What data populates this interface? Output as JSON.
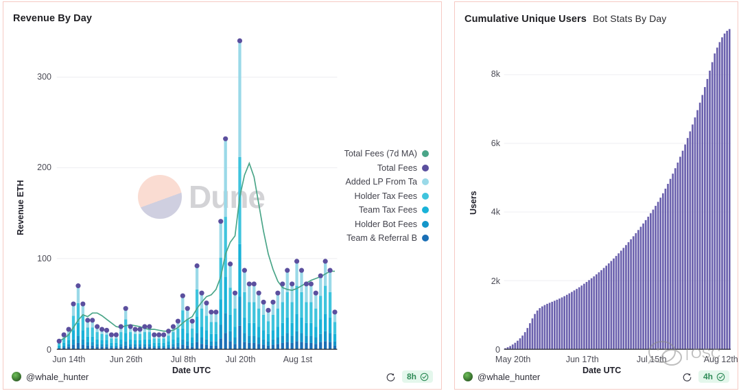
{
  "panels": {
    "left": {
      "title": "Revenue By Day",
      "subtitle": "",
      "user": "@whale_hunter",
      "freshness": "8h",
      "icons": {
        "refresh": "refresh-icon",
        "check": "check-circle-icon",
        "avatar": "avatar-icon"
      }
    },
    "right": {
      "title": "Cumulative Unique Users",
      "subtitle": "Bot Stats By Day",
      "user": "@whale_hunter",
      "freshness": "4h",
      "icons": {
        "refresh": "refresh-icon",
        "check": "check-circle-icon",
        "avatar": "avatar-icon"
      }
    }
  },
  "watermark": {
    "text": "Dune",
    "circle_top": "#fadcd2",
    "circle_bottom": "#cfcfe0"
  },
  "colors": {
    "panel_border": "#f6c9c3",
    "total_fees_ma": "#4aa588",
    "total_fees": "#5b4f9e",
    "added_lp": "#9ad9e8",
    "holder_tax": "#3fc4dd",
    "team_tax": "#19b2d8",
    "holder_bot": "#1496c9",
    "team_referral": "#1a6fb5",
    "users_bar": "#6a60ad",
    "grid": "#ededf1"
  },
  "chart_data": [
    {
      "type": "bar",
      "id": "revenue-by-day",
      "title": "Revenue By Day",
      "xlabel": "Date UTC",
      "ylabel": "Revenue ETH",
      "ylim": [
        0,
        345
      ],
      "yticks": [
        "0",
        "100",
        "200",
        "300"
      ],
      "ytick_values": [
        0,
        100,
        200,
        300
      ],
      "xticks": [
        "Jun 14th",
        "Jun 26th",
        "Jul 8th",
        "Jul 20th",
        "Aug 1st"
      ],
      "xtick_indices": [
        2,
        14,
        26,
        38,
        50
      ],
      "grid": true,
      "legend_position": "right",
      "stacked": true,
      "legend": [
        {
          "label": "Total Fees (7d MA)",
          "color": "#4aa588",
          "kind": "line"
        },
        {
          "label": "Total Fees",
          "color": "#5b4f9e",
          "kind": "scatter"
        },
        {
          "label": "Added LP From Ta",
          "color": "#9ad9e8",
          "kind": "bar"
        },
        {
          "label": "Holder Tax Fees",
          "color": "#3fc4dd",
          "kind": "bar"
        },
        {
          "label": "Team Tax Fees",
          "color": "#19b2d8",
          "kind": "bar"
        },
        {
          "label": "Holder Bot Fees",
          "color": "#1496c9",
          "kind": "bar"
        },
        {
          "label": "Team & Referral B",
          "color": "#1a6fb5",
          "kind": "bar"
        }
      ],
      "categories": [
        "Jun 12th",
        "Jun 13th",
        "Jun 14th",
        "Jun 15th",
        "Jun 16th",
        "Jun 17th",
        "Jun 18th",
        "Jun 19th",
        "Jun 20th",
        "Jun 21st",
        "Jun 22nd",
        "Jun 23rd",
        "Jun 24th",
        "Jun 25th",
        "Jun 26th",
        "Jun 27th",
        "Jun 28th",
        "Jun 29th",
        "Jun 30th",
        "Jul 1st",
        "Jul 2nd",
        "Jul 3rd",
        "Jul 4th",
        "Jul 5th",
        "Jul 6th",
        "Jul 7th",
        "Jul 8th",
        "Jul 9th",
        "Jul 10th",
        "Jul 11th",
        "Jul 12th",
        "Jul 13th",
        "Jul 14th",
        "Jul 15th",
        "Jul 16th",
        "Jul 17th",
        "Jul 18th",
        "Jul 19th",
        "Jul 20th",
        "Jul 21st",
        "Jul 22nd",
        "Jul 23rd",
        "Jul 24th",
        "Jul 25th",
        "Jul 26th",
        "Jul 27th",
        "Jul 28th",
        "Jul 29th",
        "Jul 30th",
        "Jul 31st",
        "Aug 1st",
        "Aug 2nd",
        "Aug 3rd",
        "Aug 4th",
        "Aug 5th",
        "Aug 6th",
        "Aug 7th",
        "Aug 8th",
        "Aug 9th"
      ],
      "series": [
        {
          "name": "Team & Referral B",
          "color": "#1a6fb5",
          "values": [
            1,
            2,
            3,
            5,
            7,
            5,
            4,
            4,
            3,
            3,
            3,
            2,
            2,
            3,
            4,
            3,
            3,
            3,
            3,
            3,
            2,
            2,
            2,
            2,
            3,
            3,
            5,
            4,
            3,
            8,
            6,
            5,
            4,
            4,
            12,
            18,
            9,
            6,
            26,
            8,
            7,
            7,
            6,
            5,
            4,
            5,
            6,
            7,
            8,
            7,
            9,
            8,
            7,
            7,
            6,
            8,
            9,
            8,
            4
          ]
        },
        {
          "name": "Holder Bot Fees",
          "color": "#1496c9",
          "values": [
            1,
            2,
            3,
            6,
            8,
            6,
            4,
            4,
            3,
            3,
            3,
            2,
            2,
            3,
            5,
            3,
            3,
            3,
            3,
            3,
            2,
            2,
            2,
            3,
            3,
            4,
            6,
            5,
            4,
            10,
            7,
            6,
            5,
            5,
            15,
            22,
            11,
            7,
            32,
            10,
            8,
            8,
            7,
            6,
            5,
            6,
            7,
            8,
            10,
            8,
            11,
            10,
            8,
            8,
            7,
            9,
            11,
            10,
            5
          ]
        },
        {
          "name": "Team Tax Fees",
          "color": "#19b2d8",
          "values": [
            2,
            3,
            4,
            10,
            14,
            10,
            6,
            6,
            5,
            4,
            4,
            3,
            3,
            5,
            9,
            5,
            4,
            4,
            5,
            5,
            3,
            3,
            3,
            4,
            5,
            6,
            12,
            9,
            6,
            18,
            12,
            10,
            8,
            8,
            28,
            40,
            18,
            12,
            58,
            17,
            14,
            14,
            12,
            10,
            8,
            10,
            12,
            14,
            17,
            14,
            19,
            17,
            14,
            14,
            12,
            16,
            19,
            17,
            8
          ]
        },
        {
          "name": "Holder Tax Fees",
          "color": "#3fc4dd",
          "values": [
            3,
            5,
            7,
            16,
            22,
            16,
            10,
            10,
            8,
            7,
            6,
            5,
            5,
            8,
            15,
            8,
            7,
            7,
            8,
            8,
            5,
            5,
            5,
            6,
            8,
            10,
            20,
            15,
            10,
            30,
            20,
            16,
            13,
            13,
            46,
            66,
            30,
            20,
            96,
            28,
            23,
            23,
            20,
            17,
            14,
            17,
            20,
            23,
            28,
            23,
            31,
            28,
            23,
            23,
            20,
            26,
            31,
            28,
            13
          ]
        },
        {
          "name": "Added LP From Ta",
          "color": "#9ad9e8",
          "values": [
            2,
            4,
            5,
            13,
            19,
            13,
            8,
            8,
            6,
            5,
            5,
            4,
            4,
            6,
            12,
            6,
            5,
            5,
            6,
            6,
            4,
            4,
            4,
            5,
            6,
            8,
            16,
            12,
            8,
            26,
            17,
            14,
            11,
            11,
            40,
            86,
            26,
            17,
            128,
            24,
            20,
            20,
            17,
            14,
            12,
            14,
            17,
            20,
            24,
            20,
            27,
            24,
            20,
            20,
            17,
            22,
            27,
            24,
            11
          ]
        }
      ],
      "total_fees_points": [
        9,
        16,
        22,
        50,
        70,
        50,
        32,
        32,
        25,
        22,
        21,
        16,
        16,
        25,
        45,
        25,
        22,
        22,
        25,
        25,
        16,
        16,
        16,
        20,
        25,
        31,
        59,
        45,
        31,
        92,
        62,
        51,
        41,
        41,
        141,
        232,
        94,
        62,
        340,
        87,
        72,
        72,
        62,
        52,
        43,
        52,
        62,
        72,
        87,
        72,
        97,
        87,
        72,
        72,
        62,
        81,
        97,
        87,
        41
      ],
      "total_fees_ma_7d": [
        9,
        12,
        16,
        24,
        32,
        38,
        36,
        40,
        40,
        37,
        33,
        29,
        25,
        24,
        26,
        27,
        26,
        25,
        23,
        22,
        22,
        21,
        20,
        20,
        21,
        24,
        29,
        33,
        36,
        45,
        52,
        58,
        60,
        66,
        80,
        105,
        118,
        125,
        168,
        192,
        205,
        190,
        160,
        130,
        105,
        88,
        75,
        68,
        66,
        65,
        67,
        70,
        73,
        76,
        78,
        80,
        83,
        86,
        86
      ]
    },
    {
      "type": "bar",
      "id": "cumulative-unique-users",
      "title": "Cumulative Unique Users",
      "subtitle": "Bot Stats By Day",
      "xlabel": "Date UTC",
      "ylabel": "Users",
      "ylim": [
        0,
        9400
      ],
      "yticks": [
        "0",
        "2k",
        "4k",
        "6k",
        "8k"
      ],
      "ytick_values": [
        0,
        2000,
        4000,
        6000,
        8000
      ],
      "xticks": [
        "May 20th",
        "Jun 17th",
        "Jul 15th",
        "Aug 12th"
      ],
      "xtick_indices": [
        3,
        31,
        59,
        87
      ],
      "grid": true,
      "color": "#6a60ad",
      "values": [
        30,
        60,
        95,
        140,
        190,
        250,
        320,
        400,
        500,
        620,
        760,
        900,
        1030,
        1130,
        1200,
        1250,
        1290,
        1325,
        1355,
        1385,
        1415,
        1445,
        1478,
        1512,
        1548,
        1588,
        1630,
        1672,
        1716,
        1760,
        1808,
        1858,
        1910,
        1962,
        2016,
        2070,
        2126,
        2184,
        2244,
        2306,
        2370,
        2436,
        2504,
        2574,
        2646,
        2720,
        2796,
        2874,
        2954,
        3036,
        3120,
        3206,
        3294,
        3384,
        3476,
        3570,
        3666,
        3764,
        3864,
        3966,
        4070,
        4180,
        4296,
        4418,
        4546,
        4680,
        4820,
        4966,
        5118,
        5276,
        5440,
        5610,
        5786,
        5968,
        6156,
        6350,
        6550,
        6756,
        6968,
        7186,
        7410,
        7640,
        7876,
        8118,
        8366,
        8620,
        8790,
        8950,
        9090,
        9200,
        9280,
        9330
      ]
    }
  ]
}
